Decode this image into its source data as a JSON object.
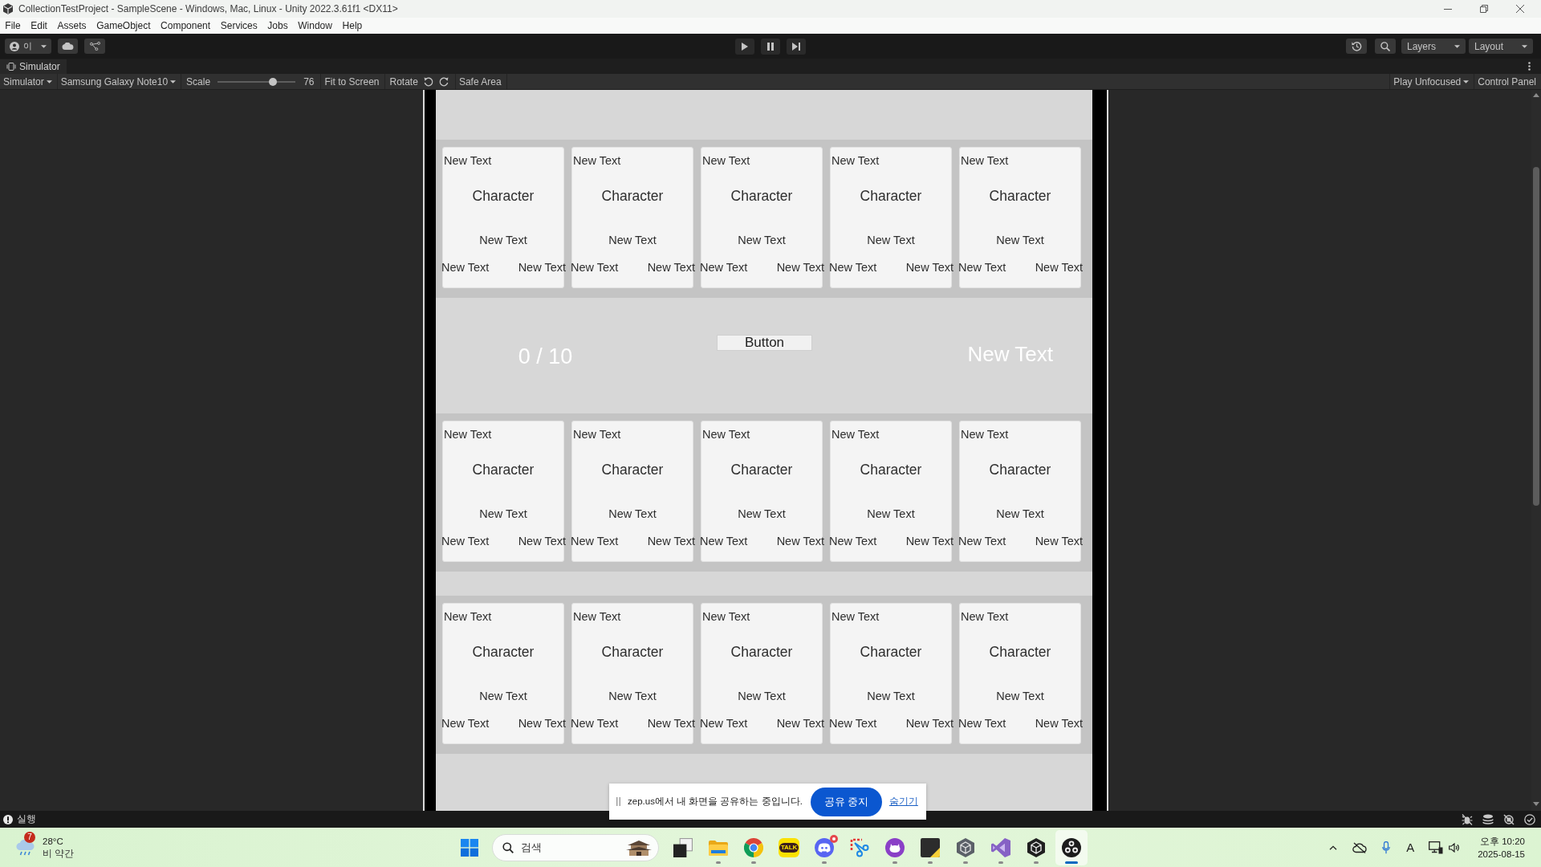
{
  "window": {
    "title": "CollectionTestProject - SampleScene - Windows, Mac, Linux - Unity 2022.3.61f1 <DX11>"
  },
  "menu_bar": {
    "items": [
      "File",
      "Edit",
      "Assets",
      "GameObject",
      "Component",
      "Services",
      "Jobs",
      "Window",
      "Help"
    ]
  },
  "toolbar": {
    "account": {
      "initial": "이"
    },
    "layers_dropdown": {
      "label": "Layers"
    },
    "layout_dropdown": {
      "label": "Layout"
    }
  },
  "simulator": {
    "tab": {
      "label": "Simulator"
    },
    "toolbar": {
      "view_dropdown": "Simulator",
      "device_dropdown": "Samsung Galaxy Note10",
      "scale": {
        "label": "Scale",
        "level": 0.71,
        "reading": "76"
      },
      "fit_to_screen": "Fit to Screen",
      "rotate_label": "Rotate",
      "safe_area": "Safe Area",
      "play_mode_dropdown": "Play Unfocused",
      "control_panel": "Control Panel"
    },
    "game_view": {
      "sections": [
        {
          "kind": "card_row",
          "cards": [
            {
              "corner_label": "New Text",
              "title": "Character",
              "subtitle": "New Text",
              "bottom_left": "New Text",
              "bottom_right": "New Text"
            },
            {
              "corner_label": "New Text",
              "title": "Character",
              "subtitle": "New Text",
              "bottom_left": "New Text",
              "bottom_right": "New Text"
            },
            {
              "corner_label": "New Text",
              "title": "Character",
              "subtitle": "New Text",
              "bottom_left": "New Text",
              "bottom_right": "New Text"
            },
            {
              "corner_label": "New Text",
              "title": "Character",
              "subtitle": "New Text",
              "bottom_left": "New Text",
              "bottom_right": "New Text"
            },
            {
              "corner_label": "New Text",
              "title": "Character",
              "subtitle": "New Text",
              "bottom_left": "New Text",
              "bottom_right": "New Text"
            }
          ]
        },
        {
          "kind": "hud",
          "counter": "0 / 10",
          "button": "Button",
          "label": "New Text"
        },
        {
          "kind": "card_row",
          "cards": [
            {
              "corner_label": "New Text",
              "title": "Character",
              "subtitle": "New Text",
              "bottom_left": "New Text",
              "bottom_right": "New Text"
            },
            {
              "corner_label": "New Text",
              "title": "Character",
              "subtitle": "New Text",
              "bottom_left": "New Text",
              "bottom_right": "New Text"
            },
            {
              "corner_label": "New Text",
              "title": "Character",
              "subtitle": "New Text",
              "bottom_left": "New Text",
              "bottom_right": "New Text"
            },
            {
              "corner_label": "New Text",
              "title": "Character",
              "subtitle": "New Text",
              "bottom_left": "New Text",
              "bottom_right": "New Text"
            },
            {
              "corner_label": "New Text",
              "title": "Character",
              "subtitle": "New Text",
              "bottom_left": "New Text",
              "bottom_right": "New Text"
            }
          ]
        },
        {
          "kind": "card_row",
          "cards": [
            {
              "corner_label": "New Text",
              "title": "Character",
              "subtitle": "New Text",
              "bottom_left": "New Text",
              "bottom_right": "New Text"
            },
            {
              "corner_label": "New Text",
              "title": "Character",
              "subtitle": "New Text",
              "bottom_left": "New Text",
              "bottom_right": "New Text"
            },
            {
              "corner_label": "New Text",
              "title": "Character",
              "subtitle": "New Text",
              "bottom_left": "New Text",
              "bottom_right": "New Text"
            },
            {
              "corner_label": "New Text",
              "title": "Character",
              "subtitle": "New Text",
              "bottom_left": "New Text",
              "bottom_right": "New Text"
            },
            {
              "corner_label": "New Text",
              "title": "Character",
              "subtitle": "New Text",
              "bottom_left": "New Text",
              "bottom_right": "New Text"
            }
          ]
        }
      ]
    }
  },
  "status_bar": {
    "message": "실행"
  },
  "share_bar": {
    "message": "zep.us에서 내 화면을 공유하는 중입니다.",
    "stop_button": "공유 중지",
    "hide_link": "숨기기"
  },
  "taskbar": {
    "weather": {
      "badge": "7",
      "temperature": "28°C",
      "condition": "비 약간"
    },
    "search": {
      "placeholder": "검색"
    },
    "apps": [
      {
        "kind": "task-view",
        "running": false,
        "selected": false,
        "notification": false
      },
      {
        "kind": "folder",
        "running": true,
        "selected": false,
        "notification": false
      },
      {
        "kind": "browser",
        "running": true,
        "selected": false,
        "notification": false
      },
      {
        "kind": "talk",
        "label": "TALK",
        "running": false,
        "selected": false,
        "notification": false
      },
      {
        "kind": "voice-chat",
        "running": true,
        "selected": false,
        "notification": true
      },
      {
        "kind": "snip",
        "running": false,
        "selected": false,
        "notification": false
      },
      {
        "kind": "git",
        "running": true,
        "selected": false,
        "notification": false
      },
      {
        "kind": "note",
        "running": true,
        "selected": false,
        "notification": false
      },
      {
        "kind": "cube",
        "running": true,
        "selected": false,
        "notification": false
      },
      {
        "kind": "ide",
        "running": true,
        "selected": false,
        "notification": false
      },
      {
        "kind": "hub",
        "running": true,
        "selected": false,
        "notification": false
      },
      {
        "kind": "recorder",
        "running": true,
        "selected": true,
        "notification": false
      }
    ],
    "tray": {
      "input_mode": "A"
    },
    "clock": {
      "time": "오후 10:20",
      "date": "2025-08-15"
    }
  }
}
